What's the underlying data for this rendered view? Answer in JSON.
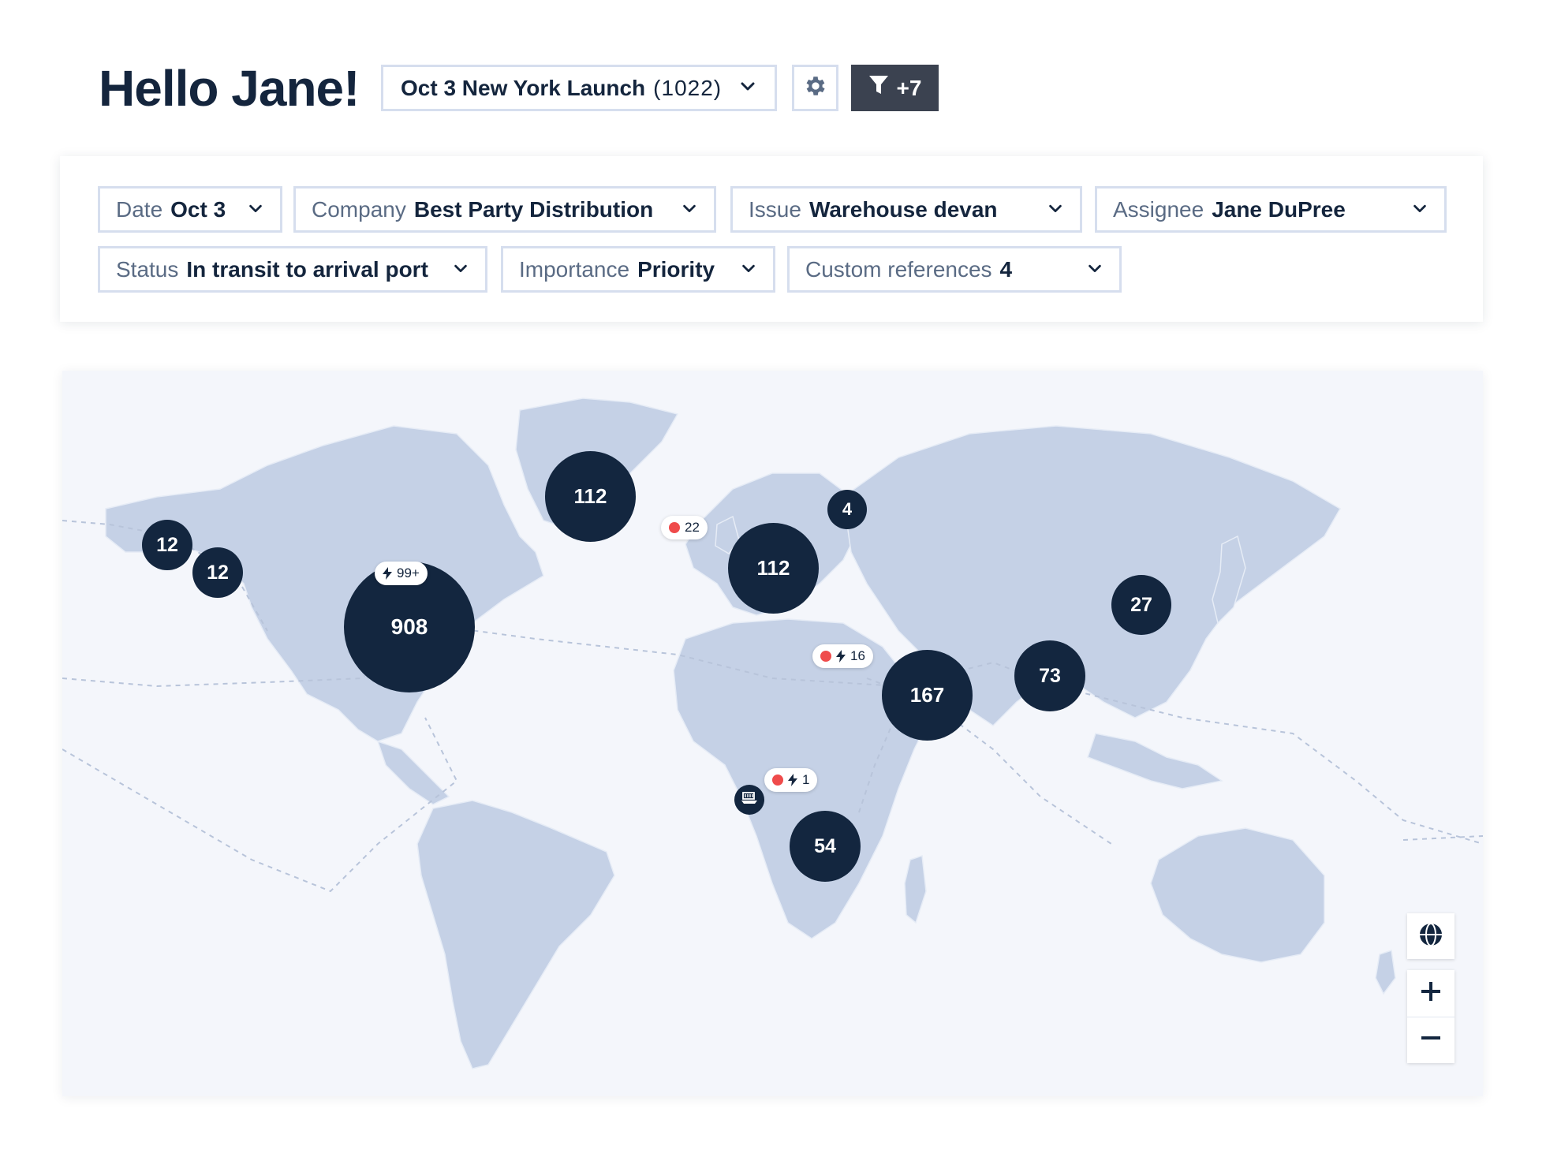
{
  "header": {
    "greeting": "Hello Jane!",
    "launch_name": "Oct 3 New York Launch",
    "launch_count": "(1022)",
    "filter_button_label": "+7"
  },
  "filters": [
    {
      "label": "Date",
      "value": "Oct 3"
    },
    {
      "label": "Company",
      "value": "Best Party Distribution"
    },
    {
      "label": "Issue",
      "value": "Warehouse devan"
    },
    {
      "label": "Assignee",
      "value": "Jane DuPree"
    },
    {
      "label": "Status",
      "value": "In transit to arrival port"
    },
    {
      "label": "Importance",
      "value": "Priority"
    },
    {
      "label": "Custom references",
      "value": "4"
    }
  ],
  "map": {
    "clusters": [
      {
        "id": "greenland",
        "count": "112"
      },
      {
        "id": "alaska",
        "count": "12"
      },
      {
        "id": "canada-west",
        "count": "12"
      },
      {
        "id": "north-america",
        "count": "908"
      },
      {
        "id": "europe",
        "count": "112"
      },
      {
        "id": "russia",
        "count": "4"
      },
      {
        "id": "japan",
        "count": "27"
      },
      {
        "id": "east-asia",
        "count": "73"
      },
      {
        "id": "south-asia",
        "count": "167"
      },
      {
        "id": "south-africa",
        "count": "54"
      }
    ],
    "badges": [
      {
        "id": "north-america",
        "alert_dot": false,
        "bolt": true,
        "text": "99+"
      },
      {
        "id": "europe",
        "alert_dot": true,
        "bolt": false,
        "text": "22"
      },
      {
        "id": "south-asia",
        "alert_dot": true,
        "bolt": true,
        "text": "16"
      },
      {
        "id": "madagascar",
        "alert_dot": true,
        "bolt": true,
        "text": "1"
      }
    ],
    "controls": {
      "zoom_in": "+",
      "zoom_out": "−"
    }
  },
  "colors": {
    "navy": "#13263f",
    "land": "#c5d1e6",
    "ocean": "#f4f6fb",
    "alert": "#ef4b4b",
    "border": "#d6deee"
  },
  "icons": [
    "chevron-down-icon",
    "gear-icon",
    "filter-icon",
    "bolt-icon",
    "ship-icon",
    "globe-icon",
    "plus-icon",
    "minus-icon"
  ]
}
